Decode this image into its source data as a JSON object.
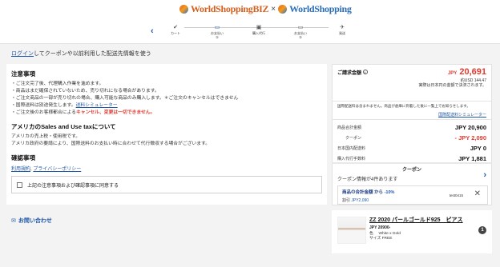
{
  "brand": {
    "biz_name": "WorldShoppingBIZ",
    "separator": "×",
    "ws_name": "WorldShopping"
  },
  "steps": [
    {
      "label": "カート",
      "icon": "cart-icon"
    },
    {
      "label": "お支払い",
      "num": "①",
      "icon": "card-icon"
    },
    {
      "label": "購入代行",
      "icon": "gift-icon"
    },
    {
      "label": "お支払い",
      "num": "②",
      "icon": "card-icon"
    },
    {
      "label": "発送",
      "icon": "plane-icon"
    }
  ],
  "notice": {
    "login_link": "ログイン",
    "text": "してクーポンや以前利用した配送先情報を使う"
  },
  "cautions": {
    "title": "注意事項",
    "items": [
      "・ご注文完了後、代理購入作業を進めます。",
      "・商品はまだ確保されていないため、売り切れになる場合があります。",
      "・ご注文商品の一部が売り切れの場合、購入可能な商品のみ購入します。＊ご注文のキャンセルはできません",
      "・国際送料は別途発生します。",
      "・ご注文後のお客様都合による"
    ],
    "shipping_link": "送料シミュレーター",
    "cancel_warning": "キャンセル、変更は一切できません。"
  },
  "tax": {
    "title": "アメリカのSales and Use taxについて",
    "line1": "アメリカの売上税・使用税です。",
    "line2": "アメリカ政府の要請により、国際送料のお支払い時に合わせて代行徴収する場合がございます。"
  },
  "confirm": {
    "title": "確認事項",
    "terms": "利用規約",
    "sep": ", ",
    "privacy": "プライバシーポリシー",
    "agree_label": "上記の注意事項および確認事項に同意する"
  },
  "contact": {
    "label": "お問い合わせ"
  },
  "summary": {
    "title": "ご請求金額",
    "currency": "JPY",
    "total": "20,691",
    "usd": "約USD 144.47",
    "usd_note": "実際は日本円の金額で決済されます。",
    "intl_note": "国際配送料は含まれません。商品が倉庫に到着した後に一覧上でお知らせします。",
    "intl_link": "国際配送料シミュレーター",
    "rows": [
      {
        "label": "商品合計金額",
        "value": "JPY 20,900"
      },
      {
        "label": "クーポン",
        "value": "- JPY 2,090"
      },
      {
        "label": "日本国内配送料",
        "value": "JPY 0"
      },
      {
        "label": "購入代行手数料",
        "value": "JPY 1,881"
      }
    ]
  },
  "coupon": {
    "title": "クーポン",
    "info": "クーポン情報が4件あります",
    "card_title_prefix": "商品の合計金額 から ",
    "card_title_pct": "-10%",
    "card_sub_prefix": "割引 ",
    "card_sub_amount": "JPY2,090",
    "code": "test0415"
  },
  "product": {
    "name": "ZZ 2020 パールゴールド925　ピアス",
    "price": "JPY 20900-",
    "color_label": "色",
    "color_value": "White x Gold",
    "size_label": "サイズ",
    "size_value": "FREE",
    "qty": "1"
  }
}
